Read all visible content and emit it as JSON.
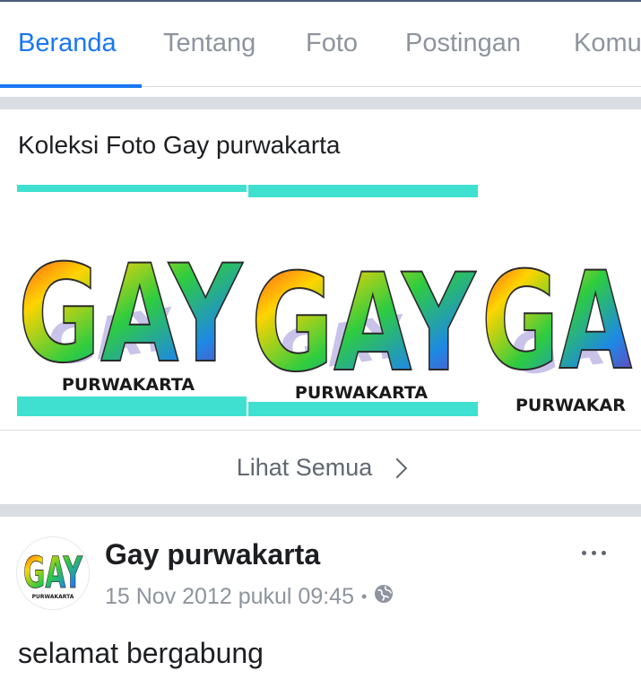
{
  "tabs": [
    {
      "label": "Beranda",
      "active": true
    },
    {
      "label": "Tentang",
      "active": false
    },
    {
      "label": "Foto",
      "active": false
    },
    {
      "label": "Postingan",
      "active": false
    },
    {
      "label": "Komu",
      "active": false
    }
  ],
  "collection": {
    "title": "Koleksi Foto Gay purwakarta",
    "photos": [
      {
        "logo_word": "GAY",
        "caption": "PURWAKARTA"
      },
      {
        "logo_word": "GAY",
        "caption": "PURWAKARTA"
      },
      {
        "logo_word": "GA",
        "caption": "PURWAKAR"
      }
    ],
    "see_all_label": "Lihat Semua"
  },
  "post": {
    "author": "Gay purwakarta",
    "avatar": {
      "logo_word": "GAY",
      "caption": "PURWAKARTA"
    },
    "timestamp": "15 Nov 2012 pukul 09:45",
    "separator": "•",
    "privacy_icon": "globe-icon",
    "text": "selamat bergabung"
  },
  "colors": {
    "accent": "#1877f2",
    "tab_inactive": "#8d949e",
    "photo_band": "#40e0d0",
    "divider": "#dadde1"
  }
}
